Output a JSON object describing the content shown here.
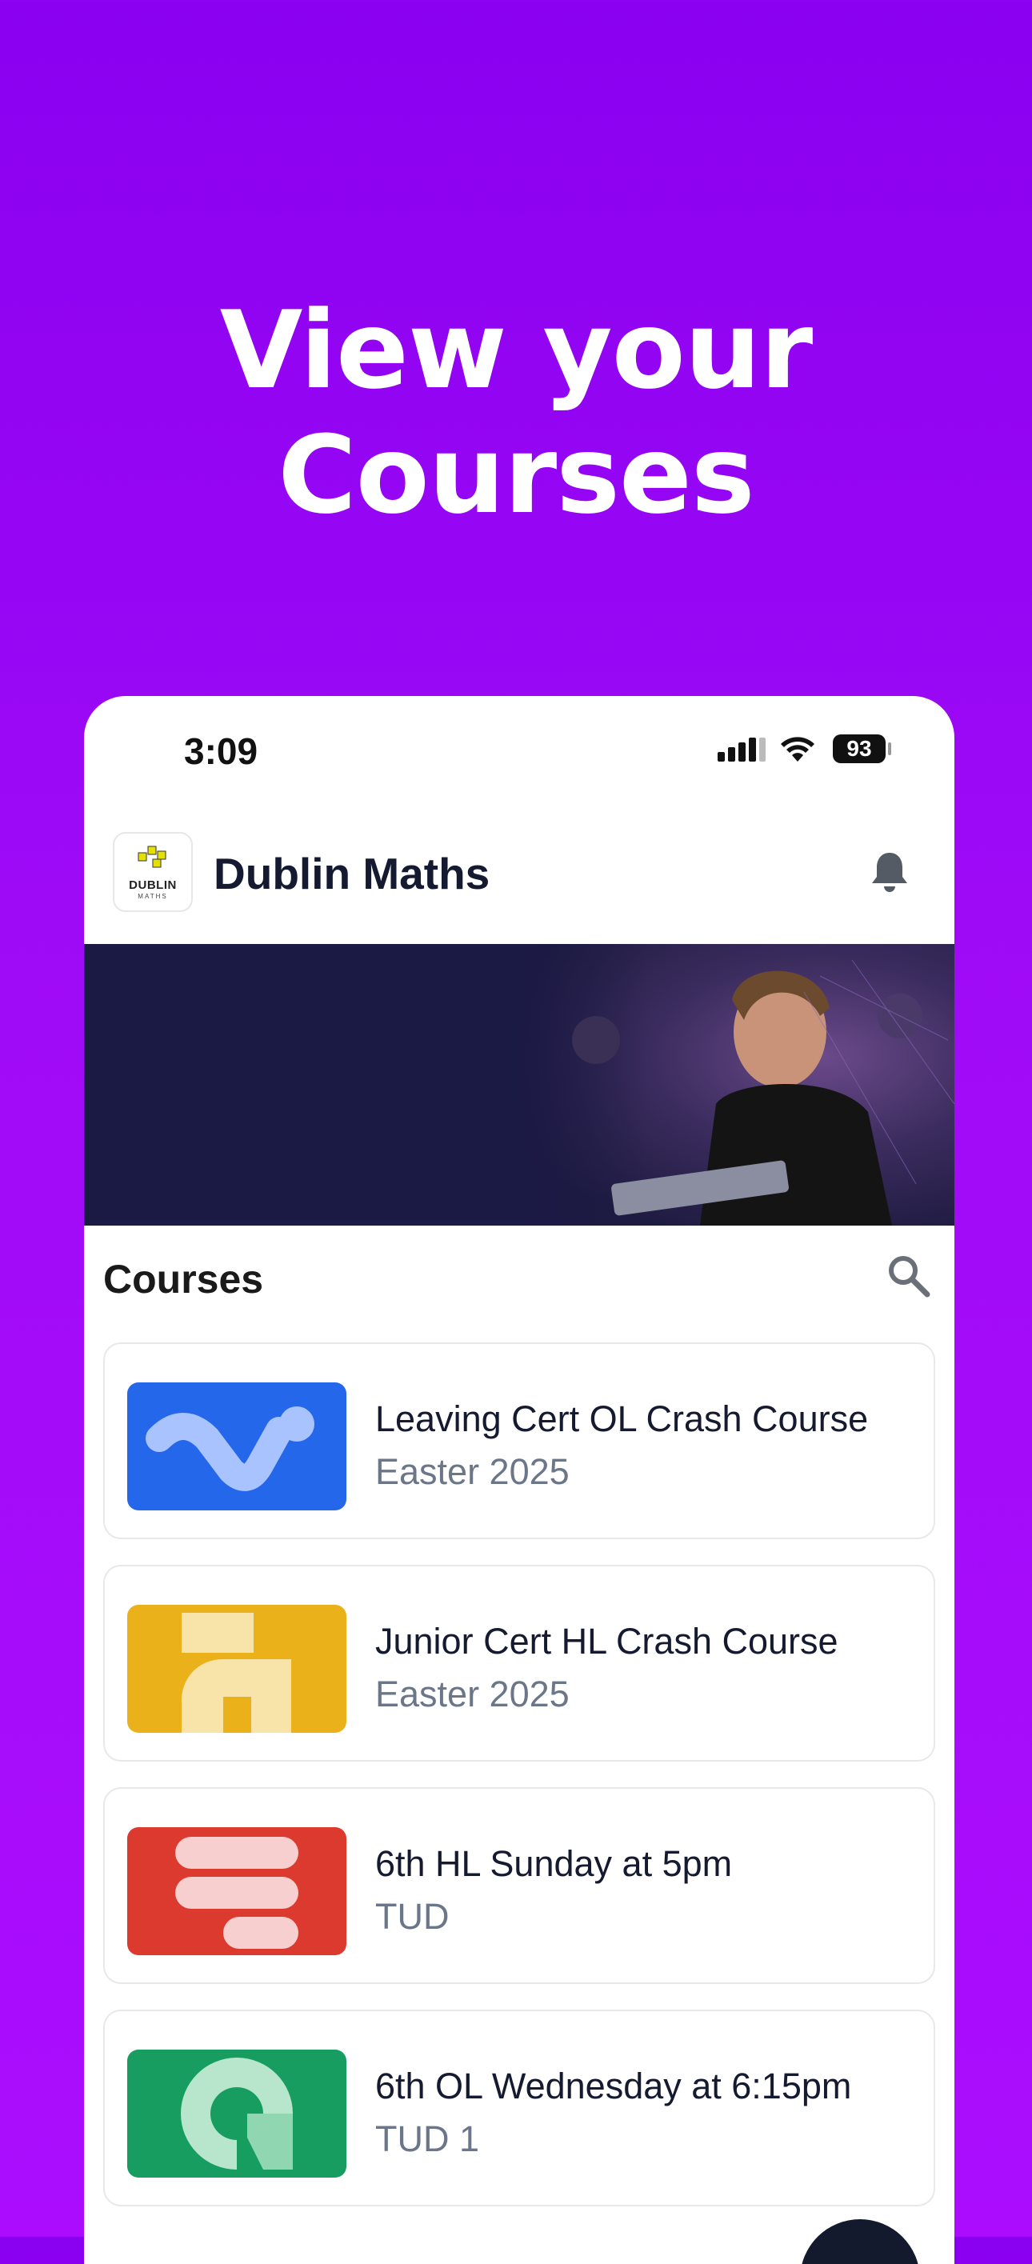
{
  "promo": {
    "line1": "View your",
    "line2": "Courses"
  },
  "status_bar": {
    "time": "3:09",
    "battery": "93"
  },
  "app": {
    "logo_text": "DUBLIN",
    "logo_sub": "MATHS",
    "title": "Dublin Maths",
    "bell_icon": "bell-icon"
  },
  "banner": {
    "image": "students-coding-photo"
  },
  "courses": {
    "heading": "Courses",
    "search_icon": "search-icon",
    "items": [
      {
        "title": "Leaving Cert OL Crash Course",
        "subtitle": "Easter 2025",
        "color": "#2467ea"
      },
      {
        "title": "Junior Cert HL Crash Course",
        "subtitle": "Easter 2025",
        "color": "#ebb11a"
      },
      {
        "title": "6th HL Sunday at 5pm",
        "subtitle": "TUD",
        "color": "#dd3a2f"
      },
      {
        "title": "6th OL Wednesday at 6:15pm",
        "subtitle": "TUD 1",
        "color": "#179d5f"
      }
    ]
  },
  "colors": {
    "background_top": "#8a00f0",
    "background_bottom": "#ab0cfd",
    "text_primary": "#151a30",
    "text_secondary": "#6b7688"
  }
}
